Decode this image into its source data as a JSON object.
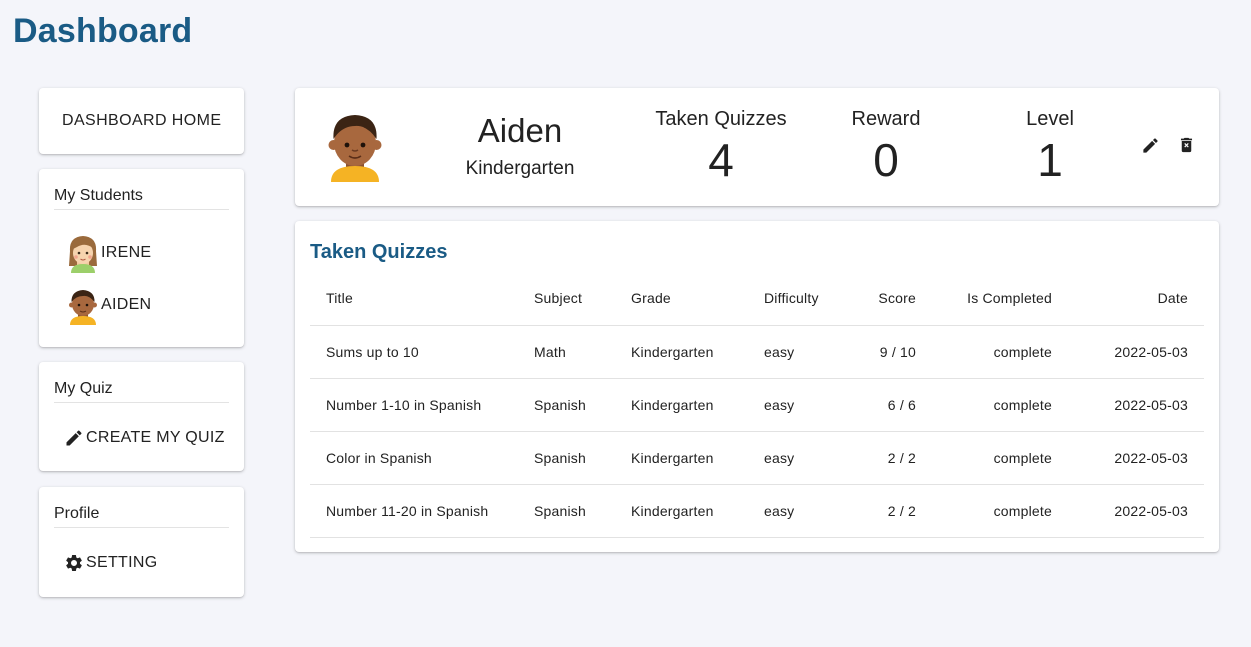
{
  "header": {
    "title": "Dashboard"
  },
  "sidebar": {
    "home_label": "DASHBOARD HOME",
    "students": {
      "title": "My Students",
      "items": [
        {
          "name": "IRENE"
        },
        {
          "name": "AIDEN"
        }
      ]
    },
    "quiz": {
      "title": "My Quiz",
      "create_label": "CREATE MY QUIZ"
    },
    "profile": {
      "title": "Profile",
      "setting_label": "SETTING"
    }
  },
  "student": {
    "name": "Aiden",
    "grade": "Kindergarten",
    "stats": {
      "taken_label": "Taken Quizzes",
      "taken_value": "4",
      "reward_label": "Reward",
      "reward_value": "0",
      "level_label": "Level",
      "level_value": "1"
    }
  },
  "quizzes": {
    "title": "Taken Quizzes",
    "columns": [
      "Title",
      "Subject",
      "Grade",
      "Difficulty",
      "Score",
      "Is Completed",
      "Date"
    ],
    "rows": [
      [
        "Sums up to 10",
        "Math",
        "Kindergarten",
        "easy",
        "9 / 10",
        "complete",
        "2022-05-03"
      ],
      [
        "Number 1-10 in Spanish",
        "Spanish",
        "Kindergarten",
        "easy",
        "6 / 6",
        "complete",
        "2022-05-03"
      ],
      [
        "Color in Spanish",
        "Spanish",
        "Kindergarten",
        "easy",
        "2 / 2",
        "complete",
        "2022-05-03"
      ],
      [
        "Number 11-20 in Spanish",
        "Spanish",
        "Kindergarten",
        "easy",
        "2 / 2",
        "complete",
        "2022-05-03"
      ]
    ]
  },
  "colors": {
    "accent": "#1a5b85",
    "background": "#f4f5fa"
  },
  "icons": [
    "pencil-icon",
    "gear-icon",
    "trash-icon",
    "girl-avatar",
    "boy-avatar"
  ]
}
